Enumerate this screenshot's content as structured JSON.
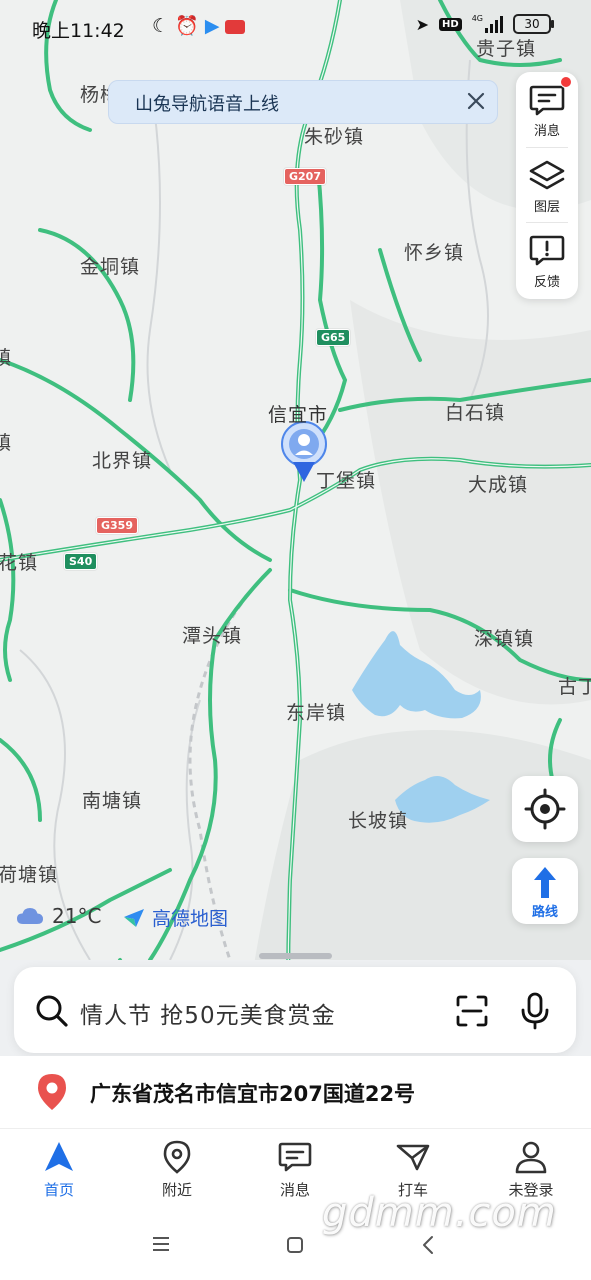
{
  "status_bar": {
    "time": "晚上11:42",
    "network": "4G",
    "hd": "HD",
    "battery": "30"
  },
  "banner": {
    "text": "山兔导航语音上线"
  },
  "tools": {
    "messages_label": "消息",
    "layers_label": "图层",
    "feedback_label": "反馈"
  },
  "map": {
    "places": [
      {
        "name": "贵子镇"
      },
      {
        "name": "杨梅"
      },
      {
        "name": "朱砂镇"
      },
      {
        "name": "金垌镇"
      },
      {
        "name": "怀乡镇"
      },
      {
        "name": "信宜市"
      },
      {
        "name": "白石镇"
      },
      {
        "name": "北界镇"
      },
      {
        "name": "丁堡镇"
      },
      {
        "name": "大成镇"
      },
      {
        "name": "花镇"
      },
      {
        "name": "潭头镇"
      },
      {
        "name": "深镇镇"
      },
      {
        "name": "东岸镇"
      },
      {
        "name": "古丁"
      },
      {
        "name": "南塘镇"
      },
      {
        "name": "长坡镇"
      },
      {
        "name": "荷塘镇"
      },
      {
        "name": "镇"
      },
      {
        "name": "镇"
      }
    ],
    "shields": [
      {
        "code": "G207",
        "color": "red"
      },
      {
        "code": "G65",
        "color": "green"
      },
      {
        "code": "G359",
        "color": "red"
      },
      {
        "code": "S40",
        "color": "green"
      }
    ]
  },
  "route_label": "路线",
  "weather": {
    "temperature": "21°C"
  },
  "brand": "高德地图",
  "search": {
    "placeholder": "情人节 抢50元美食赏金"
  },
  "address": "广东省茂名市信宜市207国道22号",
  "nav": {
    "items": [
      {
        "label": "首页",
        "active": true
      },
      {
        "label": "附近",
        "active": false
      },
      {
        "label": "消息",
        "active": false
      },
      {
        "label": "打车",
        "active": false
      },
      {
        "label": "未登录",
        "active": false
      }
    ]
  },
  "watermark": "gdmm.com",
  "colors": {
    "accent": "#1f6fe6",
    "road_green": "#3fbf7f",
    "water": "#9fd0ef",
    "pin_red": "#e9524e"
  }
}
